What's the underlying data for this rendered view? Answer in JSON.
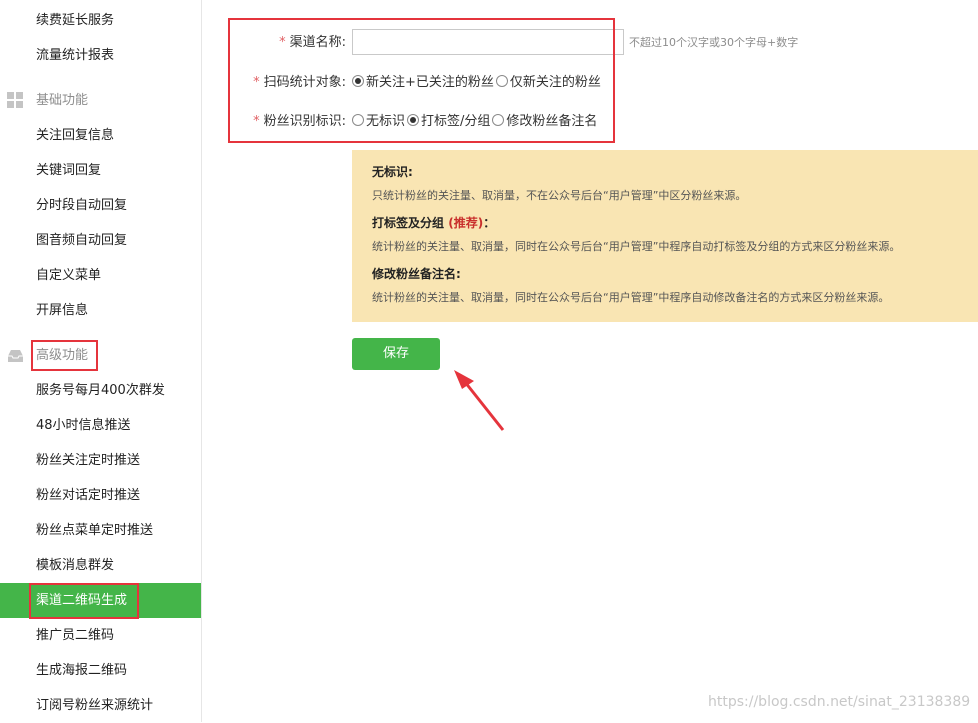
{
  "sidebar": {
    "items_top": [
      "续费延长服务",
      "流量统计报表"
    ],
    "section_basic": "基础功能",
    "items_basic": [
      "关注回复信息",
      "关键词回复",
      "分时段自动回复",
      "图音频自动回复",
      "自定义菜单",
      "开屏信息"
    ],
    "section_advanced": "高级功能",
    "items_advanced": [
      "服务号每月400次群发",
      "48小时信息推送",
      "粉丝关注定时推送",
      "粉丝对话定时推送",
      "粉丝点菜单定时推送",
      "模板消息群发",
      "渠道二维码生成",
      "推广员二维码",
      "生成海报二维码",
      "订阅号粉丝来源统计"
    ]
  },
  "form": {
    "required_mark": "*",
    "channel_name_label": "渠道名称:",
    "channel_name_value": "",
    "channel_name_hint": "不超过10个汉字或30个字母+数字",
    "scan_target_label": "扫码统计对象:",
    "scan_target_options": [
      "新关注+已关注的粉丝",
      "仅新关注的粉丝"
    ],
    "scan_target_selected": 0,
    "fan_mark_label": "粉丝识别标识:",
    "fan_mark_options": [
      "无标识",
      "打标签/分组",
      "修改粉丝备注名"
    ],
    "fan_mark_selected": 1
  },
  "info": {
    "title1": "无标识:",
    "desc1": "只统计粉丝的关注量、取消量，不在公众号后台“用户管理”中区分粉丝来源。",
    "title2": "打标签及分组",
    "title2_rec": "(推荐)",
    "title2_suffix": "：",
    "desc2": "统计粉丝的关注量、取消量，同时在公众号后台“用户管理”中程序自动打标签及分组的方式来区分粉丝来源。",
    "title3": "修改粉丝备注名:",
    "desc3": "统计粉丝的关注量、取消量，同时在公众号后台“用户管理”中程序自动修改备注名的方式来区分粉丝来源。"
  },
  "save_label": "保存",
  "watermark": "https://blog.csdn.net/sinat_23138389",
  "colors": {
    "accent": "#44b549",
    "annotation": "#e5343c",
    "info_bg": "#f9e5b3",
    "required": "#e15f63"
  },
  "icons": {
    "basic": "grid-icon",
    "advanced": "inbox-icon"
  }
}
